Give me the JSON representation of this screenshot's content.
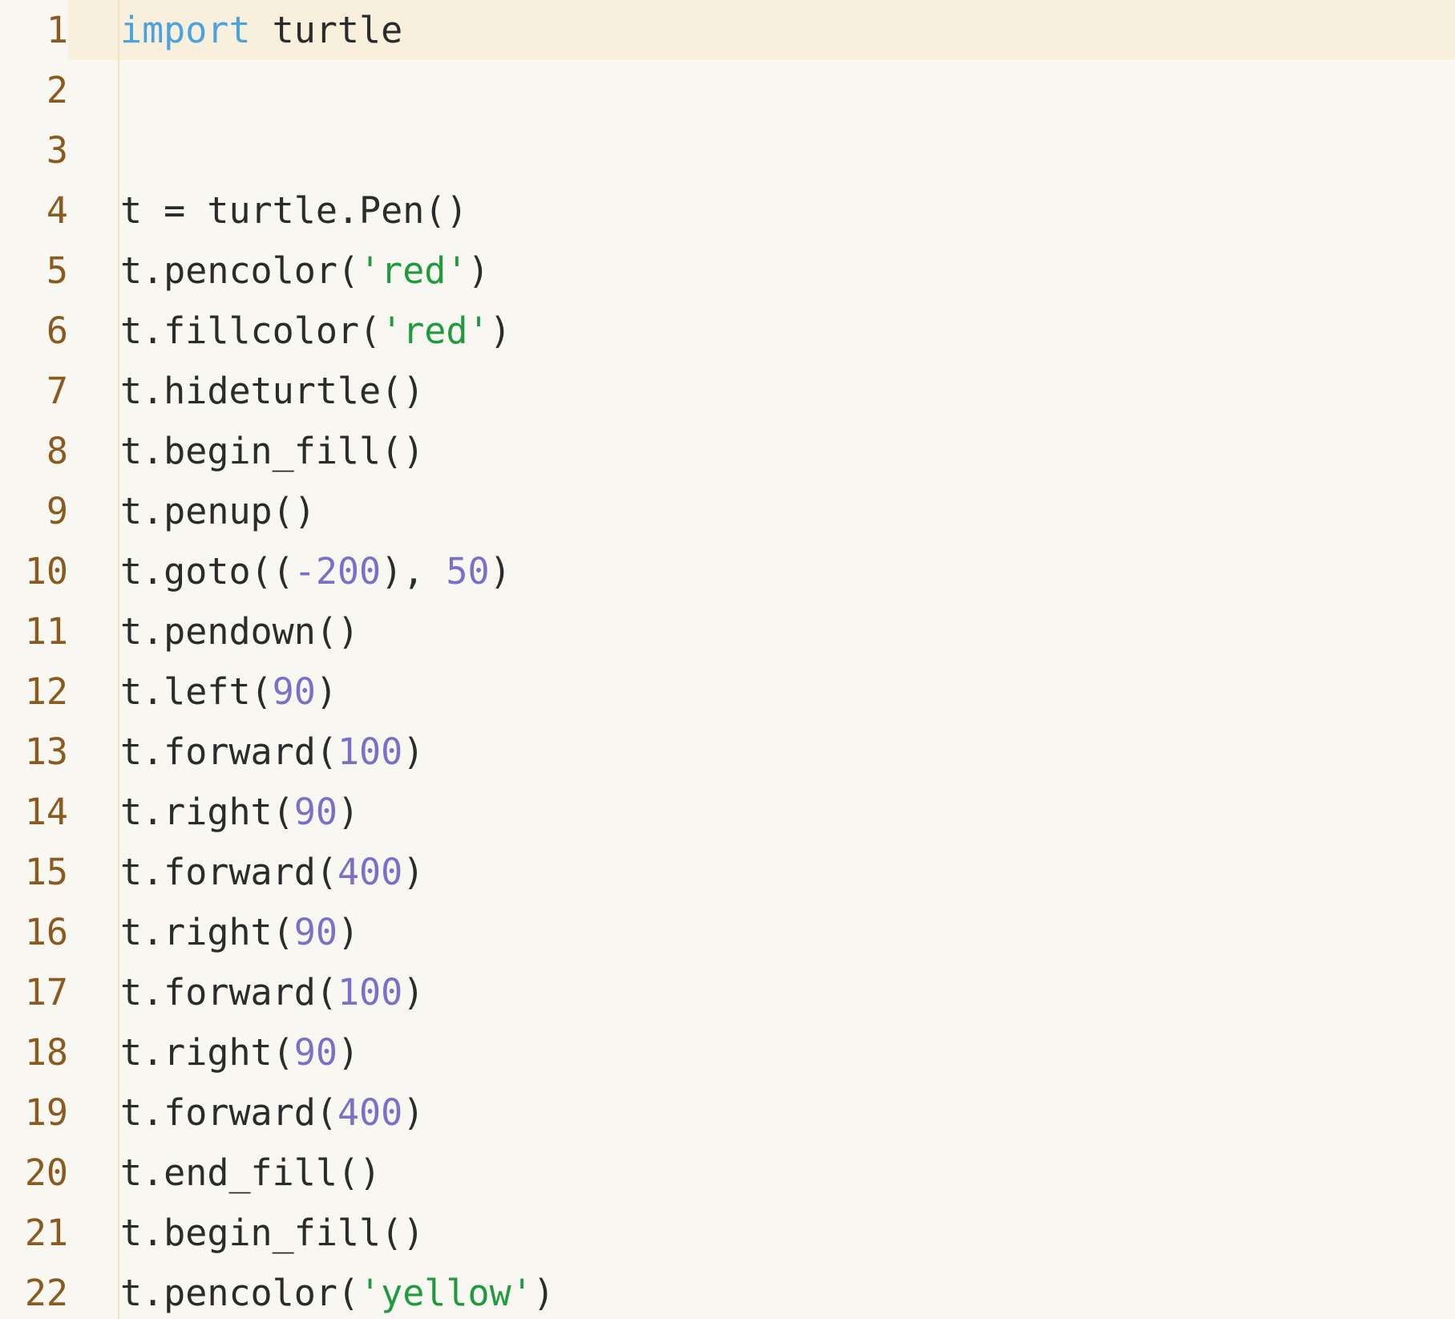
{
  "editor": {
    "active_line": 1,
    "colors": {
      "background": "#f8f7f1",
      "active_line": "#f8f0dc",
      "line_number": "#8b5a1f",
      "keyword": "#4aa3df",
      "string": "#1f9a3c",
      "number": "#7b6fc9",
      "text": "#2b2b2b"
    },
    "lines": [
      {
        "n": "1",
        "tokens": [
          {
            "t": "import",
            "c": "kw"
          },
          {
            "t": " turtle",
            "c": ""
          }
        ]
      },
      {
        "n": "2",
        "tokens": []
      },
      {
        "n": "3",
        "tokens": []
      },
      {
        "n": "4",
        "tokens": [
          {
            "t": "t = turtle.Pen()",
            "c": ""
          }
        ]
      },
      {
        "n": "5",
        "tokens": [
          {
            "t": "t.pencolor(",
            "c": ""
          },
          {
            "t": "'red'",
            "c": "str"
          },
          {
            "t": ")",
            "c": ""
          }
        ]
      },
      {
        "n": "6",
        "tokens": [
          {
            "t": "t.fillcolor(",
            "c": ""
          },
          {
            "t": "'red'",
            "c": "str"
          },
          {
            "t": ")",
            "c": ""
          }
        ]
      },
      {
        "n": "7",
        "tokens": [
          {
            "t": "t.hideturtle()",
            "c": ""
          }
        ]
      },
      {
        "n": "8",
        "tokens": [
          {
            "t": "t.begin_fill()",
            "c": ""
          }
        ]
      },
      {
        "n": "9",
        "tokens": [
          {
            "t": "t.penup()",
            "c": ""
          }
        ]
      },
      {
        "n": "10",
        "tokens": [
          {
            "t": "t.goto((",
            "c": ""
          },
          {
            "t": "-200",
            "c": "num"
          },
          {
            "t": "), ",
            "c": ""
          },
          {
            "t": "50",
            "c": "num"
          },
          {
            "t": ")",
            "c": ""
          }
        ]
      },
      {
        "n": "11",
        "tokens": [
          {
            "t": "t.pendown()",
            "c": ""
          }
        ]
      },
      {
        "n": "12",
        "tokens": [
          {
            "t": "t.left(",
            "c": ""
          },
          {
            "t": "90",
            "c": "num"
          },
          {
            "t": ")",
            "c": ""
          }
        ]
      },
      {
        "n": "13",
        "tokens": [
          {
            "t": "t.forward(",
            "c": ""
          },
          {
            "t": "100",
            "c": "num"
          },
          {
            "t": ")",
            "c": ""
          }
        ]
      },
      {
        "n": "14",
        "tokens": [
          {
            "t": "t.right(",
            "c": ""
          },
          {
            "t": "90",
            "c": "num"
          },
          {
            "t": ")",
            "c": ""
          }
        ]
      },
      {
        "n": "15",
        "tokens": [
          {
            "t": "t.forward(",
            "c": ""
          },
          {
            "t": "400",
            "c": "num"
          },
          {
            "t": ")",
            "c": ""
          }
        ]
      },
      {
        "n": "16",
        "tokens": [
          {
            "t": "t.right(",
            "c": ""
          },
          {
            "t": "90",
            "c": "num"
          },
          {
            "t": ")",
            "c": ""
          }
        ]
      },
      {
        "n": "17",
        "tokens": [
          {
            "t": "t.forward(",
            "c": ""
          },
          {
            "t": "100",
            "c": "num"
          },
          {
            "t": ")",
            "c": ""
          }
        ]
      },
      {
        "n": "18",
        "tokens": [
          {
            "t": "t.right(",
            "c": ""
          },
          {
            "t": "90",
            "c": "num"
          },
          {
            "t": ")",
            "c": ""
          }
        ]
      },
      {
        "n": "19",
        "tokens": [
          {
            "t": "t.forward(",
            "c": ""
          },
          {
            "t": "400",
            "c": "num"
          },
          {
            "t": ")",
            "c": ""
          }
        ]
      },
      {
        "n": "20",
        "tokens": [
          {
            "t": "t.end_fill()",
            "c": ""
          }
        ]
      },
      {
        "n": "21",
        "tokens": [
          {
            "t": "t.begin_fill()",
            "c": ""
          }
        ]
      },
      {
        "n": "22",
        "tokens": [
          {
            "t": "t.pencolor(",
            "c": ""
          },
          {
            "t": "'yellow'",
            "c": "str"
          },
          {
            "t": ")",
            "c": ""
          }
        ]
      }
    ]
  }
}
